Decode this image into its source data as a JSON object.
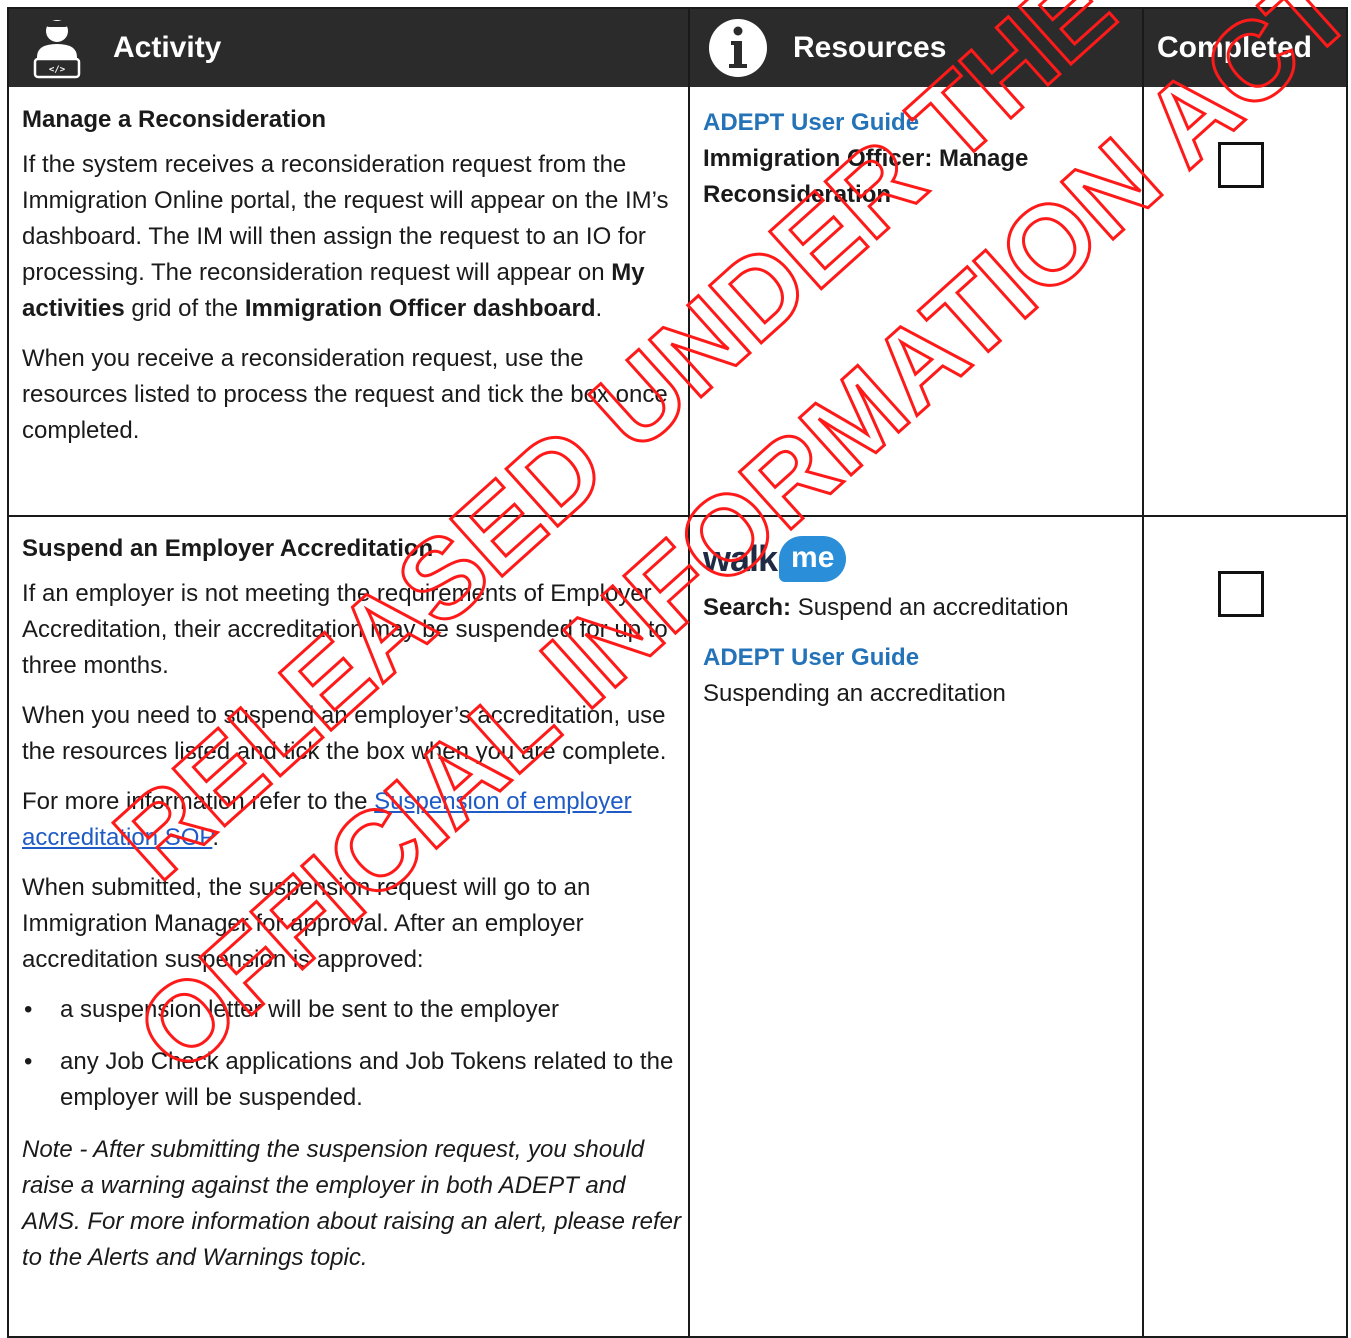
{
  "header": {
    "activity": "Activity",
    "resources": "Resources",
    "completed": "Completed",
    "activity_icon": "developer-person-icon",
    "resources_icon": "info-icon"
  },
  "rows": [
    {
      "title": "Manage a Reconsideration",
      "p1_a": "If the system receives a reconsideration request from the Immigration Online portal, the request will appear on the IM’s dashboard. The IM will then assign the request to an IO for processing. The reconsideration request will appear on ",
      "p1_b": "My activities",
      "p1_c": " grid of the ",
      "p1_d": "Immigration Officer dashboard",
      "p1_e": ".",
      "p2": "When you receive a reconsideration request, use the resources listed to process the request and tick the box once completed.",
      "res_link": "ADEPT User Guide",
      "res_text": "Immigration Officer: Manage Reconsideration",
      "checked": false
    },
    {
      "title": "Suspend an Employer Accreditation",
      "p1": "If an employer is not meeting the requirements of Employer Accreditation, their accreditation may be suspended for up to three months.",
      "p2": "When you need to suspend an employer’s accreditation, use the resources listed and tick the box when you are complete.",
      "p3_a": "For more information refer to the ",
      "p3_link": "Suspension of employer accreditation SOP",
      "p3_b": ".",
      "p4": "When submitted, the suspension request will go to an Immigration Manager for approval. After an employer accreditation suspension is approved:",
      "bullets": [
        "a suspension letter will be sent to the employer",
        "any Job Check applications and Job Tokens related to the employer will be suspended."
      ],
      "note": "Note - After submitting the suspension request, you should raise a warning against the employer in both ADEPT and AMS. For more information about raising an alert, please refer to the Alerts and Warnings topic.",
      "walkme_walk": "walk",
      "walkme_me": "me",
      "search_label": "Search:",
      "search_text": " Suspend an accreditation",
      "res_link": "ADEPT User Guide",
      "res_text": "Suspending an accreditation",
      "checked": false
    }
  ],
  "watermark": {
    "line1": "RELEASED UNDER THE",
    "line2": "OFFICIAL INFORMATION ACT",
    "color": "#ff1a1a"
  }
}
